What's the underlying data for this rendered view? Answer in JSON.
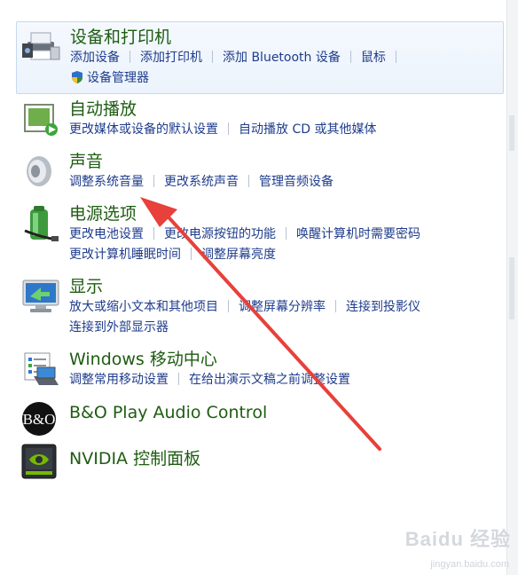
{
  "categories": [
    {
      "title": "设备和打印机",
      "icon": "printer-icon",
      "links": [
        "添加设备",
        "添加打印机",
        "添加 Bluetooth 设备",
        "鼠标"
      ],
      "links2": [
        "设备管理器"
      ],
      "links2_icon": "shield-icon"
    },
    {
      "title": "自动播放",
      "icon": "autoplay-icon",
      "links": [
        "更改媒体或设备的默认设置",
        "自动播放 CD 或其他媒体"
      ]
    },
    {
      "title": "声音",
      "icon": "speaker-icon",
      "links": [
        "调整系统音量",
        "更改系统声音",
        "管理音频设备"
      ]
    },
    {
      "title": "电源选项",
      "icon": "battery-icon",
      "links": [
        "更改电池设置",
        "更改电源按钮的功能",
        "唤醒计算机时需要密码"
      ],
      "links2": [
        "更改计算机睡眠时间",
        "调整屏幕亮度"
      ]
    },
    {
      "title": "显示",
      "icon": "monitor-icon",
      "links": [
        "放大或缩小文本和其他项目",
        "调整屏幕分辨率",
        "连接到投影仪"
      ],
      "links2": [
        "连接到外部显示器"
      ]
    },
    {
      "title": "Windows 移动中心",
      "icon": "mobility-center-icon",
      "links": [
        "调整常用移动设置",
        "在给出演示文稿之前调整设置"
      ]
    },
    {
      "title": "B&O Play Audio Control",
      "icon": "bo-logo-icon",
      "links": []
    },
    {
      "title": "NVIDIA 控制面板",
      "icon": "nvidia-icon",
      "links": []
    }
  ],
  "watermark": {
    "brand": "Baidu 经验",
    "url": "jingyan.baidu.com"
  },
  "colors": {
    "title": "#1e5c12",
    "link": "#1e3c8c",
    "arrow": "#e8403a",
    "highlight_border": "#c5d9ef"
  }
}
